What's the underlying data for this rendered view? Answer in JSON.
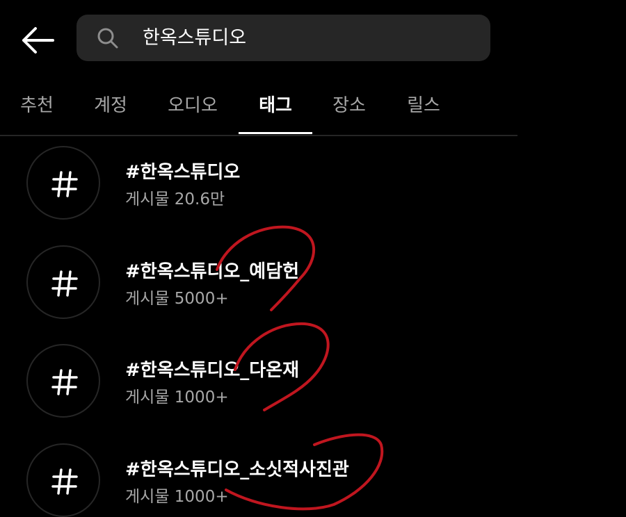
{
  "header": {
    "back_icon": "arrow-left-icon",
    "search": {
      "icon": "search-icon",
      "value": "한옥스튜디오"
    }
  },
  "tabs": [
    {
      "label": "추천",
      "active": false
    },
    {
      "label": "계정",
      "active": false
    },
    {
      "label": "오디오",
      "active": false
    },
    {
      "label": "태그",
      "active": true
    },
    {
      "label": "장소",
      "active": false
    },
    {
      "label": "릴스",
      "active": false
    }
  ],
  "results": [
    {
      "icon": "hashtag-icon",
      "tag": "#한옥스튜디오",
      "posts": "게시물 20.6만"
    },
    {
      "icon": "hashtag-icon",
      "tag": "#한옥스튜디오_예담헌",
      "posts": "게시물 5000+"
    },
    {
      "icon": "hashtag-icon",
      "tag": "#한옥스튜디오_다온재",
      "posts": "게시물 1000+"
    },
    {
      "icon": "hashtag-icon",
      "tag": "#한옥스튜디오_소싯적사진관",
      "posts": "게시물 1000+"
    }
  ],
  "colors": {
    "background": "#000000",
    "search_bg": "#262626",
    "secondary_text": "#a8a8a8",
    "annotation_red": "#c0161f"
  }
}
